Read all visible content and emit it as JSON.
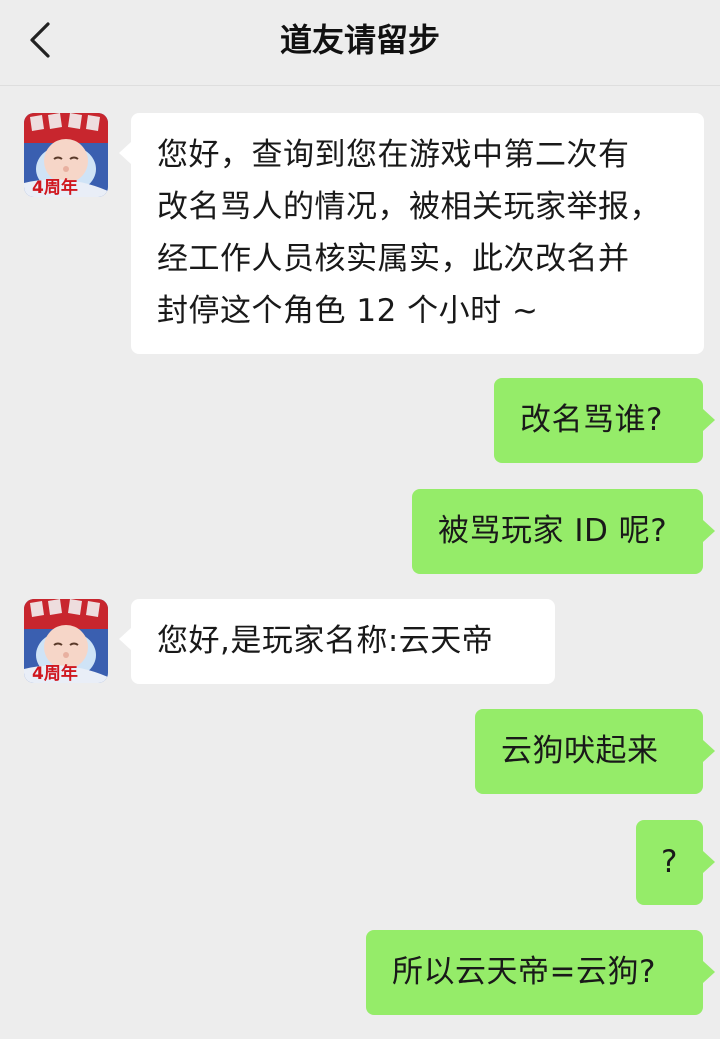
{
  "header": {
    "title": "道友请留步"
  },
  "avatar_badge": "4周年",
  "messages": [
    {
      "side": "in",
      "text": "您好，查询到您在游戏中第二次有\n改名骂人的情况，被相关玩家举报，\n经工作人员核实属实，此次改名并\n封停这个角色 12 个小时 ~"
    },
    {
      "side": "out",
      "text": "改名骂谁?"
    },
    {
      "side": "out",
      "text": "被骂玩家 ID 呢?"
    },
    {
      "side": "in",
      "text": "您好,是玩家名称:云天帝"
    },
    {
      "side": "out",
      "text": "云狗吠起来"
    },
    {
      "side": "out",
      "text": "?"
    },
    {
      "side": "out",
      "text": "所以云天帝=云狗?"
    }
  ],
  "colors": {
    "background": "#ededed",
    "incoming_bubble": "#ffffff",
    "outgoing_bubble": "#95ec69"
  }
}
